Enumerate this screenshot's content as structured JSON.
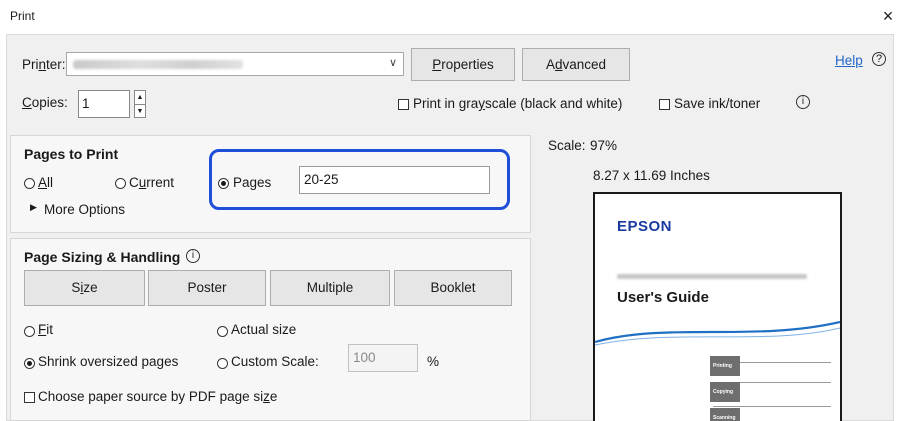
{
  "window": {
    "title": "Print",
    "close_glyph": "×"
  },
  "printer": {
    "label": "Printer:",
    "selected": "EPSON EW-C8100 Series",
    "properties_label": "Properties",
    "advanced_label": "Advanced"
  },
  "help": {
    "label": "Help"
  },
  "copies": {
    "label": "Copies:",
    "value": "1"
  },
  "options": {
    "grayscale_label": "Print in grayscale (black and white)",
    "save_ink_label": "Save ink/toner"
  },
  "pages_to_print": {
    "title": "Pages to Print",
    "all_label": "All",
    "current_label": "Current",
    "pages_label": "Pages",
    "pages_value": "20-25",
    "more_options_label": "More Options"
  },
  "sizing": {
    "title": "Page Sizing & Handling",
    "tabs": [
      "Size",
      "Poster",
      "Multiple",
      "Booklet"
    ],
    "fit_label": "Fit",
    "actual_size_label": "Actual size",
    "shrink_label": "Shrink oversized pages",
    "custom_scale_label": "Custom Scale:",
    "custom_scale_value": "100",
    "percent": "%",
    "paper_source_label": "Choose paper source by PDF page size"
  },
  "preview": {
    "scale_label": "Scale:",
    "scale_value": "97%",
    "dimensions": "8.27 x 11.69 Inches",
    "brand": "EPSON",
    "doc_title": "User's Guide",
    "index_tabs": [
      "Printing",
      "Copying",
      "Scanning"
    ]
  },
  "colors": {
    "highlight": "#1f4fd8",
    "wave": "#1f6fc4"
  }
}
